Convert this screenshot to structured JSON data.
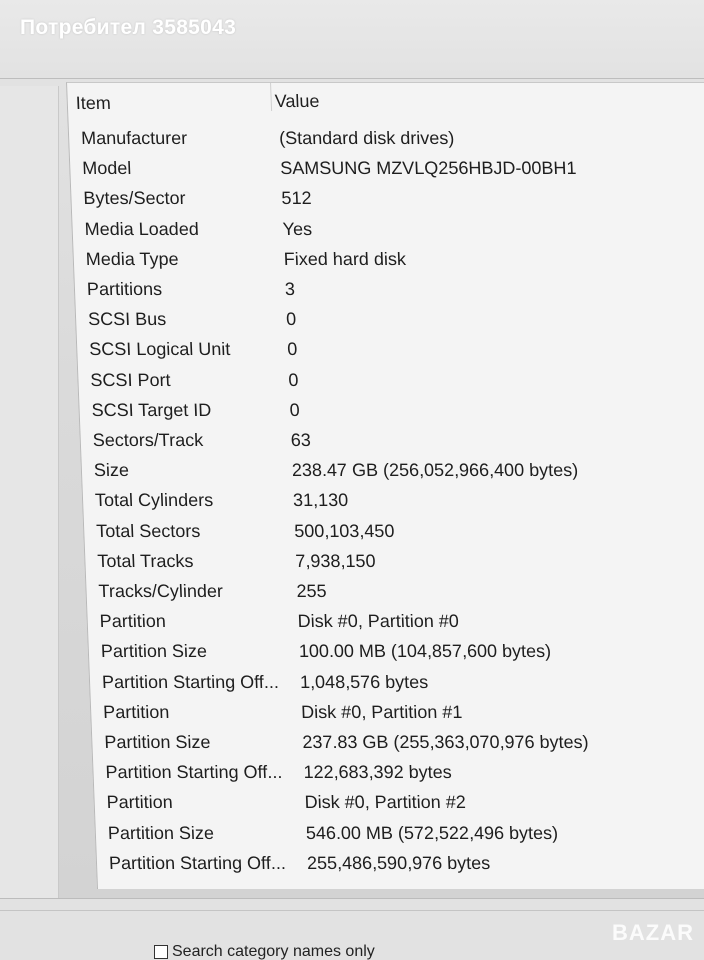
{
  "overlay": {
    "user_label": "Потребител 3585043",
    "logo_text": "BAZAR"
  },
  "table": {
    "headers": {
      "item": "Item",
      "value": "Value"
    },
    "rows": [
      {
        "item": "Manufacturer",
        "value": "(Standard disk drives)"
      },
      {
        "item": "Model",
        "value": "SAMSUNG MZVLQ256HBJD-00BH1"
      },
      {
        "item": "Bytes/Sector",
        "value": "512"
      },
      {
        "item": "Media Loaded",
        "value": "Yes"
      },
      {
        "item": "Media Type",
        "value": "Fixed hard disk"
      },
      {
        "item": "Partitions",
        "value": "3"
      },
      {
        "item": "SCSI Bus",
        "value": "0"
      },
      {
        "item": "SCSI Logical Unit",
        "value": "0"
      },
      {
        "item": "SCSI Port",
        "value": "0"
      },
      {
        "item": "SCSI Target ID",
        "value": "0"
      },
      {
        "item": "Sectors/Track",
        "value": "63"
      },
      {
        "item": "Size",
        "value": "238.47 GB (256,052,966,400 bytes)"
      },
      {
        "item": "Total Cylinders",
        "value": "31,130"
      },
      {
        "item": "Total Sectors",
        "value": "500,103,450"
      },
      {
        "item": "Total Tracks",
        "value": "7,938,150"
      },
      {
        "item": "Tracks/Cylinder",
        "value": "255"
      },
      {
        "item": "Partition",
        "value": "Disk #0, Partition #0"
      },
      {
        "item": "Partition Size",
        "value": "100.00 MB (104,857,600 bytes)"
      },
      {
        "item": "Partition Starting Off...",
        "value": "1,048,576 bytes"
      },
      {
        "item": "Partition",
        "value": "Disk #0, Partition #1"
      },
      {
        "item": "Partition Size",
        "value": "237.83 GB (255,363,070,976 bytes)"
      },
      {
        "item": "Partition Starting Off...",
        "value": "122,683,392 bytes"
      },
      {
        "item": "Partition",
        "value": "Disk #0, Partition #2"
      },
      {
        "item": "Partition Size",
        "value": "546.00 MB (572,522,496 bytes)"
      },
      {
        "item": "Partition Starting Off...",
        "value": "255,486,590,976 bytes"
      }
    ]
  },
  "footer": {
    "search_category_label": "Search category names only"
  }
}
